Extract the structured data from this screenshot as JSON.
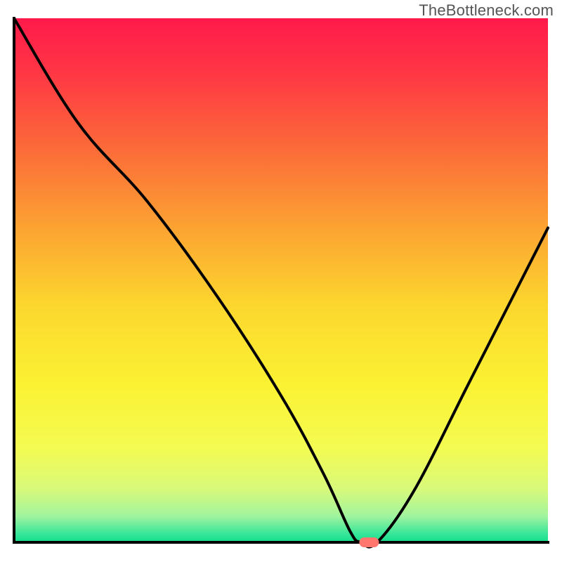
{
  "watermark": "TheBottleneck.com",
  "chart_data": {
    "type": "line",
    "title": "",
    "xlabel": "",
    "ylabel": "",
    "xlim": [
      0,
      100
    ],
    "ylim": [
      0,
      100
    ],
    "grid": false,
    "legend": false,
    "x_ticks": [],
    "y_ticks": [],
    "background_gradient": {
      "type": "vertical",
      "stops": [
        {
          "pos": 0.0,
          "color": "#ff1a4b"
        },
        {
          "pos": 0.1,
          "color": "#ff3545"
        },
        {
          "pos": 0.25,
          "color": "#fc6b39"
        },
        {
          "pos": 0.4,
          "color": "#fca332"
        },
        {
          "pos": 0.55,
          "color": "#fcd72e"
        },
        {
          "pos": 0.7,
          "color": "#fbf233"
        },
        {
          "pos": 0.82,
          "color": "#f4fb52"
        },
        {
          "pos": 0.9,
          "color": "#d7f97b"
        },
        {
          "pos": 0.95,
          "color": "#a1f49e"
        },
        {
          "pos": 0.985,
          "color": "#34e59a"
        },
        {
          "pos": 1.0,
          "color": "#12dd88"
        }
      ]
    },
    "series": [
      {
        "name": "bottleneck-curve",
        "color": "#000000",
        "x": [
          0,
          12,
          25,
          38,
          50,
          58,
          63,
          65,
          68,
          75,
          85,
          95,
          100
        ],
        "values": [
          100,
          80,
          65,
          47,
          28,
          13,
          2,
          0,
          0,
          10,
          30,
          50,
          60
        ]
      }
    ],
    "marker": {
      "name": "optimal-point",
      "x": 66.5,
      "y": 0,
      "color": "#ff766e"
    }
  }
}
